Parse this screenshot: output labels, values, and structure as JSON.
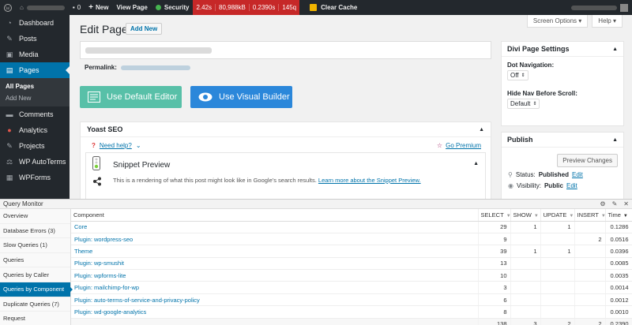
{
  "adminbar": {
    "comments_count": "0",
    "new_label": "New",
    "view_page_label": "View Page",
    "security_label": "Security",
    "qm_stats": [
      "2.42s",
      "80,988kB",
      "0.2390s",
      "145q"
    ],
    "clear_cache_label": "Clear Cache"
  },
  "sidebar": {
    "items": [
      {
        "label": "Dashboard",
        "icon": "dashboard-icon"
      },
      {
        "label": "Posts",
        "icon": "pin-icon"
      },
      {
        "label": "Media",
        "icon": "media-icon"
      },
      {
        "label": "Pages",
        "icon": "pages-icon"
      },
      {
        "label": "Comments",
        "icon": "comments-icon"
      },
      {
        "label": "Analytics",
        "icon": "analytics-icon"
      },
      {
        "label": "Projects",
        "icon": "pin-icon"
      },
      {
        "label": "WP AutoTerms",
        "icon": "autoterms-icon"
      },
      {
        "label": "WPForms",
        "icon": "forms-icon"
      }
    ],
    "submenu": [
      "All Pages",
      "Add New"
    ]
  },
  "header": {
    "screen_options": "Screen Options ▾",
    "help": "Help ▾",
    "title": "Edit Page",
    "add_new": "Add New",
    "permalink_label": "Permalink:"
  },
  "buttons": {
    "default_editor": "Use Default Editor",
    "visual_builder": "Use Visual Builder"
  },
  "yoast": {
    "title": "Yoast SEO",
    "need_help": "Need help?",
    "go_premium": "Go Premium",
    "snippet_title": "Snippet Preview",
    "snippet_desc": "This is a rendering of what this post might look like in Google's search results.",
    "snippet_link": "Learn more about the Snippet Preview."
  },
  "divi": {
    "title": "Divi Page Settings",
    "dot_nav_label": "Dot Navigation:",
    "dot_nav_value": "Off",
    "hide_nav_label": "Hide Nav Before Scroll:",
    "hide_nav_value": "Default"
  },
  "publish": {
    "title": "Publish",
    "preview_btn": "Preview Changes",
    "status_label": "Status:",
    "status_value": "Published",
    "visibility_label": "Visibility:",
    "visibility_value": "Public",
    "edit": "Edit"
  },
  "qm": {
    "title": "Query Monitor",
    "nav": [
      "Overview",
      "Database Errors (3)",
      "Slow Queries (1)",
      "Queries",
      "Queries by Caller",
      "Queries by Component",
      "Duplicate Queries (7)",
      "Request"
    ],
    "active_nav": 5,
    "headers": [
      "Component",
      "SELECT",
      "SHOW",
      "UPDATE",
      "INSERT",
      "Time"
    ],
    "rows": [
      [
        "Core",
        "29",
        "1",
        "1",
        "",
        "0.1286"
      ],
      [
        "Plugin: wordpress-seo",
        "9",
        "",
        "",
        "2",
        "0.0516"
      ],
      [
        "Theme",
        "39",
        "1",
        "1",
        "",
        "0.0396"
      ],
      [
        "Plugin: wp-smushit",
        "13",
        "",
        "",
        "",
        "0.0085"
      ],
      [
        "Plugin: wpforms-lite",
        "10",
        "",
        "",
        "",
        "0.0035"
      ],
      [
        "Plugin: mailchimp-for-wp",
        "3",
        "",
        "",
        "",
        "0.0014"
      ],
      [
        "Plugin: auto-terms-of-service-and-privacy-policy",
        "6",
        "",
        "",
        "",
        "0.0012"
      ],
      [
        "Plugin: wd-google-analytics",
        "8",
        "",
        "",
        "",
        "0.0010"
      ]
    ],
    "totals": [
      "",
      "138",
      "3",
      "2",
      "2",
      "0.2390"
    ]
  }
}
